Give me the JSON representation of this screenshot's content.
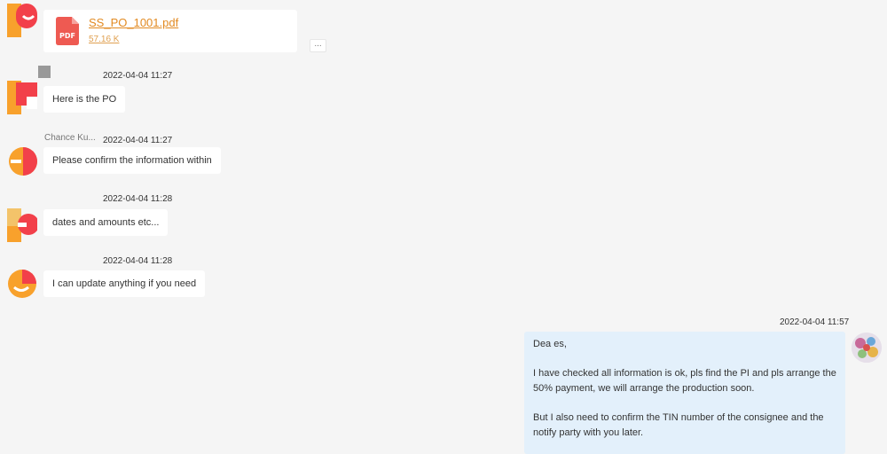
{
  "messages": [
    {
      "type": "file",
      "file_name": "SS_PO_1001.pdf",
      "file_size": "57.16 K",
      "file_badge": "PDF",
      "more_label": "..."
    },
    {
      "type": "text",
      "sender": "",
      "time": "2022-04-04 11:27",
      "text": "Here is the PO"
    },
    {
      "type": "text",
      "sender": "Chance Ku...",
      "time": "2022-04-04 11:27",
      "text": "Please confirm the information within"
    },
    {
      "type": "text",
      "sender": "",
      "time": "2022-04-04 11:28",
      "text": "dates and amounts etc..."
    },
    {
      "type": "text",
      "sender": "",
      "time": "2022-04-04 11:28",
      "text": "I can update anything if you need"
    }
  ],
  "reply": {
    "time": "2022-04-04 11:57",
    "greeting": "Dea           es,",
    "paragraph1": "I have checked all information is ok, pls find the PI and pls arrange the 50% payment, we will arrange the production soon.",
    "paragraph2": "But I also need to confirm the TIN number of the consignee and the notify party with you later."
  },
  "colors": {
    "background": "#f5f5f5",
    "bubble": "#ffffff",
    "reply_bubble": "#e3f0fb",
    "file_link": "#e28a22",
    "pdf_red": "#ee5a52",
    "avatar_red": "#f2404a",
    "avatar_orange": "#f8a12c",
    "avatar_yellow": "#fbc531"
  },
  "icons": {
    "avatar": "brand-logo-avatar",
    "file": "pdf-file-icon",
    "more": "more-dots-icon",
    "user_avatar": "user-photo-avatar"
  }
}
